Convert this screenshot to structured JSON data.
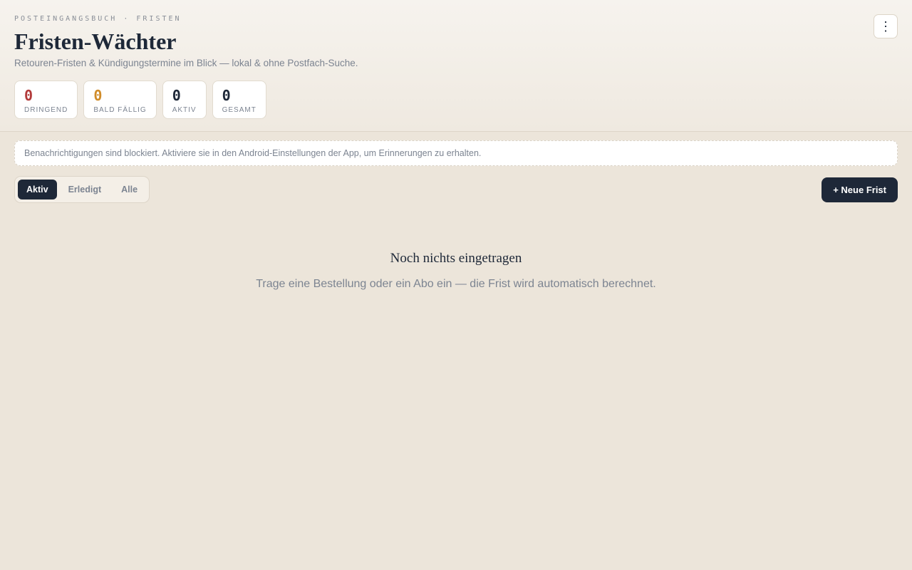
{
  "header": {
    "eyebrow": "POSTEINGANGSBUCH · FRISTEN",
    "title": "Fristen-Wächter",
    "subtitle": "Retouren-Fristen & Kündigungstermine im Blick — lokal & ohne Postfach-Suche.",
    "menu_icon": "more-vertical-icon",
    "menu_glyph": "⋮"
  },
  "stats": [
    {
      "value": "0",
      "label": "DRINGEND",
      "color": "#b23a3a"
    },
    {
      "value": "0",
      "label": "BALD FÄLLIG",
      "color": "#d08c2a"
    },
    {
      "value": "0",
      "label": "AKTIV",
      "color": "#1e2838"
    },
    {
      "value": "0",
      "label": "GESAMT",
      "color": "#1e2838"
    }
  ],
  "notice": {
    "text": "Benachrichtigungen sind blockiert. Aktiviere sie in den Android-Einstellungen der App, um Erinnerungen zu erhalten."
  },
  "tabs": [
    {
      "label": "Aktiv",
      "active": true
    },
    {
      "label": "Erledigt",
      "active": false
    },
    {
      "label": "Alle",
      "active": false
    }
  ],
  "new_button": {
    "label": "+ Neue Frist"
  },
  "empty_state": {
    "title": "Noch nichts eingetragen",
    "text": "Trage eine Bestellung oder ein Abo ein — die Frist wird automatisch berechnet."
  },
  "colors": {
    "accent": "#1e2838",
    "background": "#ece5da",
    "urgent": "#b23a3a",
    "soon": "#d08c2a"
  }
}
